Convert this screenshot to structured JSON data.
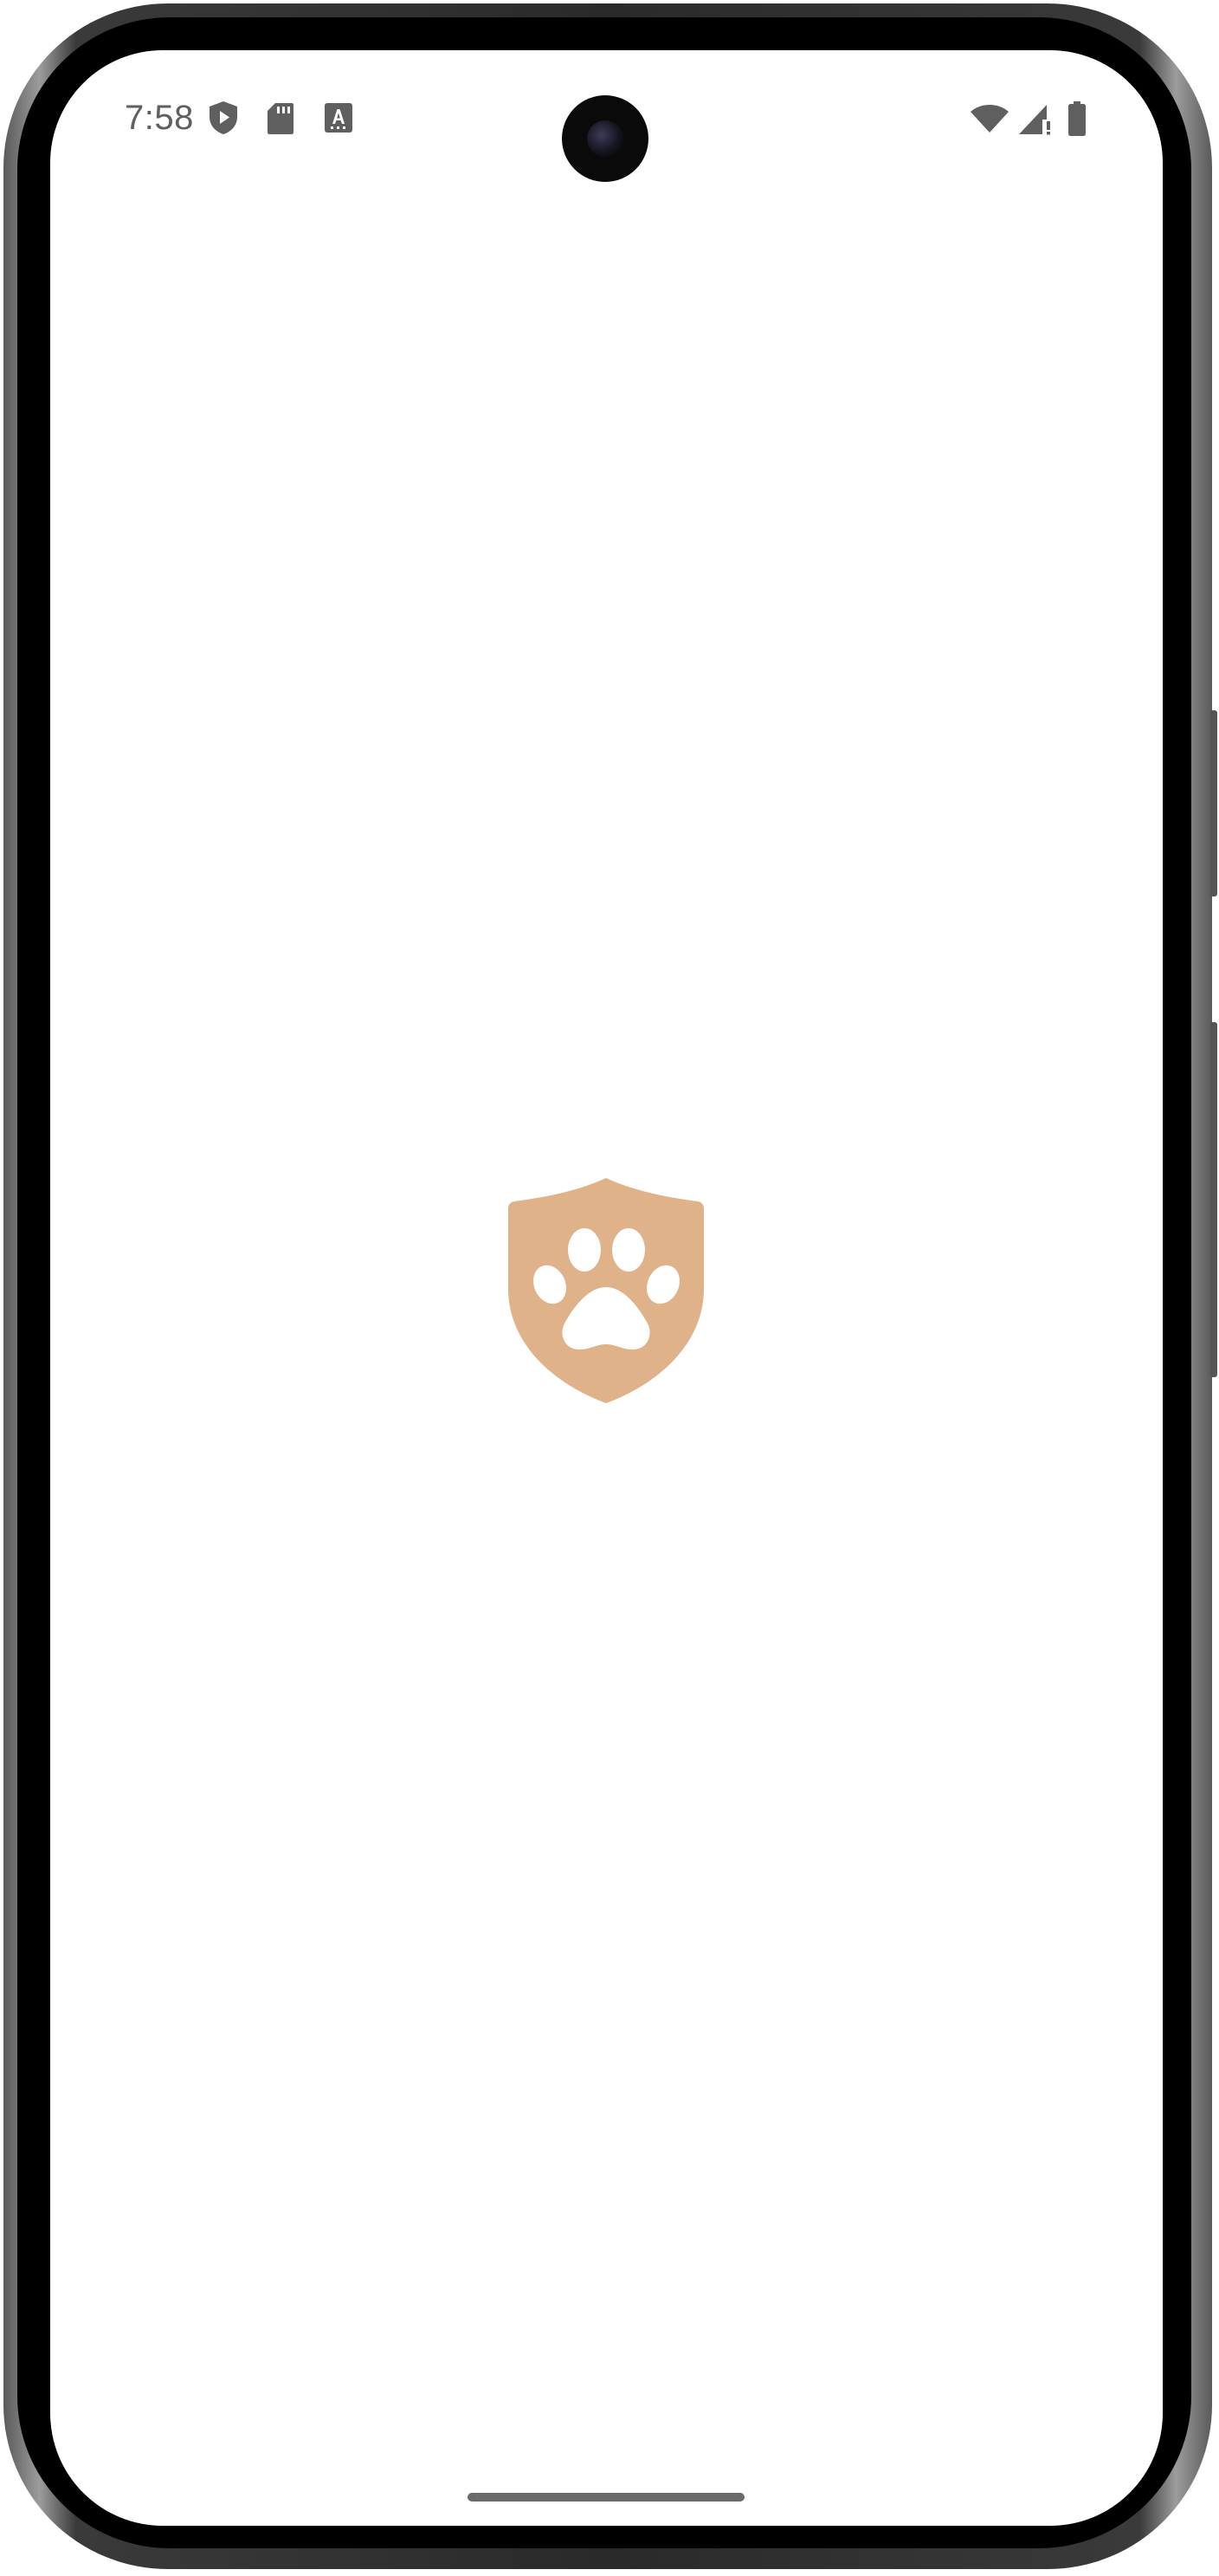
{
  "status_bar": {
    "time": "7:58",
    "left_icons": [
      "play-protect-icon",
      "sd-card-icon",
      "keyboard-a-icon"
    ],
    "right_icons": [
      "wifi-icon",
      "cell-signal-no-service-icon",
      "battery-icon"
    ],
    "icon_color": "#5f5f5f"
  },
  "splash": {
    "logo": "shield-paw-icon",
    "logo_color": "#dfb28a",
    "paw_color": "#ffffff"
  },
  "navigation": {
    "gesture_bar": "home-indicator"
  }
}
